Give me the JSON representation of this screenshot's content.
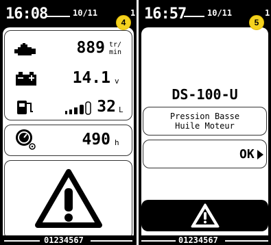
{
  "left": {
    "time": "16:08",
    "date": "10/11",
    "date_tail": "1",
    "badge": "4",
    "rpm": {
      "value": "889",
      "unit_top": "tr/",
      "unit_bottom": "min"
    },
    "battery": {
      "value": "14.1",
      "unit": "v"
    },
    "fuel": {
      "value": "32",
      "unit": "L",
      "level_bars": 4
    },
    "hours": {
      "value": "490",
      "unit": "h"
    },
    "serial": "01234567"
  },
  "right": {
    "time": "16:57",
    "date": "10/11",
    "date_tail": "1",
    "badge": "5",
    "model": "DS-100-U",
    "message_line1": "Pression Basse",
    "message_line2": "Huile Moteur",
    "ok_label": "OK",
    "serial": "01234567"
  },
  "colors": {
    "badge": "#f4d21f",
    "screen": "#000000",
    "panel": "#ffffff"
  },
  "icons": [
    "engine-icon",
    "battery-icon",
    "fuel-icon",
    "hour-meter-icon",
    "warning-icon",
    "play-arrow-icon"
  ]
}
